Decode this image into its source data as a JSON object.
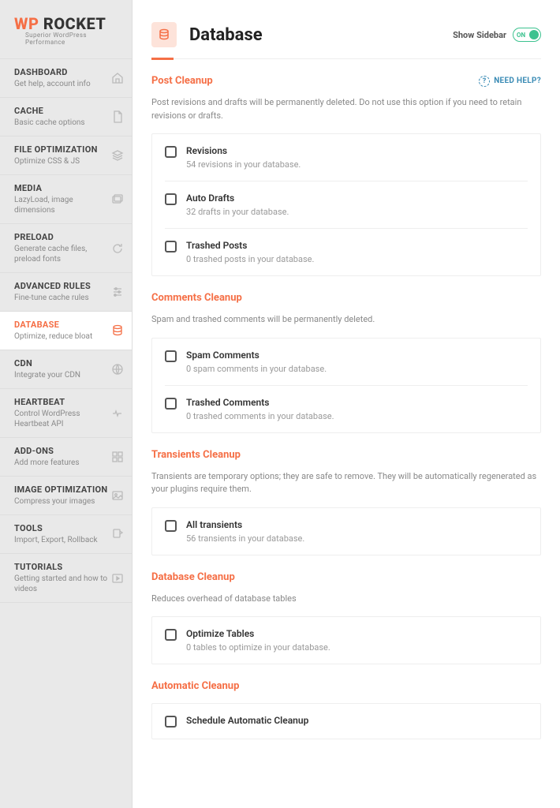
{
  "logo": {
    "part1": "WP",
    "part2": " ROCKET",
    "tagline": "Superior WordPress Performance"
  },
  "nav": [
    {
      "title": "DASHBOARD",
      "desc": "Get help, account info",
      "icon": "home"
    },
    {
      "title": "CACHE",
      "desc": "Basic cache options",
      "icon": "file"
    },
    {
      "title": "FILE OPTIMIZATION",
      "desc": "Optimize CSS & JS",
      "icon": "layers"
    },
    {
      "title": "MEDIA",
      "desc": "LazyLoad, image dimensions",
      "icon": "images"
    },
    {
      "title": "PRELOAD",
      "desc": "Generate cache files, preload fonts",
      "icon": "refresh"
    },
    {
      "title": "ADVANCED RULES",
      "desc": "Fine-tune cache rules",
      "icon": "sliders"
    },
    {
      "title": "DATABASE",
      "desc": "Optimize, reduce bloat",
      "icon": "database",
      "active": true
    },
    {
      "title": "CDN",
      "desc": "Integrate your CDN",
      "icon": "globe"
    },
    {
      "title": "HEARTBEAT",
      "desc": "Control WordPress Heartbeat API",
      "icon": "heartbeat"
    },
    {
      "title": "ADD-ONS",
      "desc": "Add more features",
      "icon": "addons"
    },
    {
      "title": "IMAGE OPTIMIZATION",
      "desc": "Compress your images",
      "icon": "image-opt"
    },
    {
      "title": "TOOLS",
      "desc": "Import, Export, Rollback",
      "icon": "tools"
    },
    {
      "title": "TUTORIALS",
      "desc": "Getting started and how to videos",
      "icon": "play"
    }
  ],
  "header": {
    "title": "Database",
    "toggleLabel": "Show Sidebar",
    "toggleValue": "ON"
  },
  "help": {
    "label": "NEED HELP?"
  },
  "sections": {
    "post": {
      "title": "Post Cleanup",
      "desc": "Post revisions and drafts will be permanently deleted. Do not use this option if you need to retain revisions or drafts.",
      "options": [
        {
          "title": "Revisions",
          "sub": "54 revisions in your database."
        },
        {
          "title": "Auto Drafts",
          "sub": "32 drafts in your database."
        },
        {
          "title": "Trashed Posts",
          "sub": "0 trashed posts in your database."
        }
      ]
    },
    "comments": {
      "title": "Comments Cleanup",
      "desc": "Spam and trashed comments will be permanently deleted.",
      "options": [
        {
          "title": "Spam Comments",
          "sub": "0 spam comments in your database."
        },
        {
          "title": "Trashed Comments",
          "sub": "0 trashed comments in your database."
        }
      ]
    },
    "transients": {
      "title": "Transients Cleanup",
      "desc": "Transients are temporary options; they are safe to remove. They will be automatically regenerated as your plugins require them.",
      "options": [
        {
          "title": "All transients",
          "sub": "56 transients in your database."
        }
      ]
    },
    "db": {
      "title": "Database Cleanup",
      "desc": "Reduces overhead of database tables",
      "options": [
        {
          "title": "Optimize Tables",
          "sub": "0 tables to optimize in your database."
        }
      ]
    },
    "auto": {
      "title": "Automatic Cleanup",
      "options": [
        {
          "title": "Schedule Automatic Cleanup"
        }
      ]
    }
  }
}
